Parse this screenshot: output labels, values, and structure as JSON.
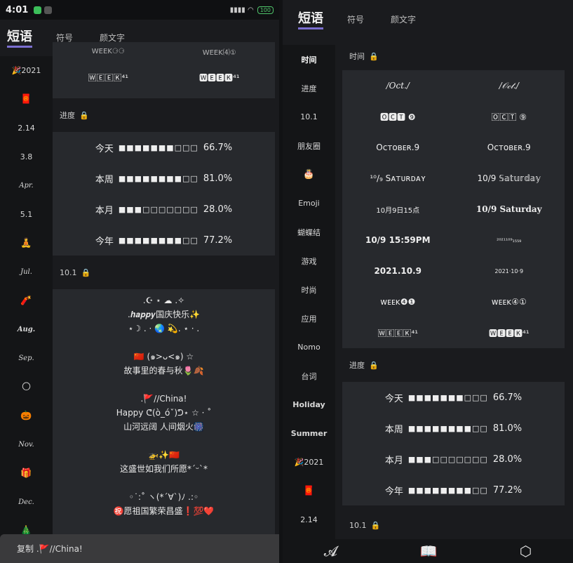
{
  "status_bar": {
    "time": "4:01",
    "battery": "100",
    "right_icons": "▮▮▮▮  ◠"
  },
  "tabs": {
    "active": "短语",
    "symbol": "符号",
    "kaomoji": "颜文字"
  },
  "left": {
    "sidebar": [
      "🎉2021",
      "🧧",
      "2.14",
      "3.8",
      "Apr.",
      "5.1",
      "🧘",
      "Jul.",
      "🧨",
      "Aug.",
      "Sep.",
      "🌕",
      "🎃",
      "Nov.",
      "🎁",
      "Dec.",
      "🎄"
    ],
    "cutoff_row": [
      "WEEK⚆⚆",
      "WEEK⑷①"
    ],
    "week_row": [
      "🅆🄴🄴🄺⁴¹",
      "🆆🅴🅴🅺⁴¹"
    ],
    "progress_header": "进度",
    "progress": [
      {
        "label": "今天",
        "bar": "■■■■■■■□□□",
        "pct": "66.7%"
      },
      {
        "label": "本周",
        "bar": "■■■■■■■■□□",
        "pct": "81.0%"
      },
      {
        "label": "本月",
        "bar": "■■■□□□□□□□",
        "pct": "28.0%"
      },
      {
        "label": "今年",
        "bar": "■■■■■■■■□□",
        "pct": "77.2%"
      }
    ],
    "s101_header": "10.1",
    "s101_blocks": [
      [
        ".☪︎ ⋆ ☁︎ .✧",
        ".𝒉𝒂𝒑𝒑𝒚国庆快乐✨",
        "⋆☽ . · 🌏 💫. ⋆ · ."
      ],
      [
        "🇨🇳 (๑>ᴗ<๑) ☆",
        "故事里的春与秋🌷🍂"
      ],
      [
        ".🚩//China!",
        "Happy ᕦ(ò_óˇ)ᕤ⋆ ☆ · ˚",
        "山河远阔 人间烟火🎆"
      ],
      [
        "🚁✨🇨🇳",
        "这盛世如我们所愿*ˊᵕˋ*"
      ],
      [
        "◦˙:˚ ヽ(*´∀`)ﾉ .:◦",
        "㊗️愿祖国繁荣昌盛❗💯❤️"
      ]
    ],
    "toast": "复制 .🚩//China!"
  },
  "right": {
    "sidebar": [
      "时间",
      "进度",
      "10.1",
      "朋友圈",
      "🎂",
      "Emoji",
      "蝴蝶结",
      "游戏",
      "时尚",
      "应用",
      "Nomo",
      "台词",
      "Holiday",
      "Summer",
      "🎉2021",
      "🧧",
      "2.14"
    ],
    "time_header": "时间",
    "time_rows": [
      [
        "/Oct./",
        "/𝒪𝒸𝓉./"
      ],
      [
        "🅾🅲🆃 ❾",
        "🄾🄲🅃 ⑨"
      ],
      [
        "Oᴄᴛᴏʙᴇʀ.9",
        "Oᴄᴛᴏʙᴇʀ.9"
      ],
      [
        "¹⁰/₉ Sᴀᴛᴜʀᴅᴀʏ",
        "10/9 𝕊𝕒𝕥𝕦𝕣𝕕𝕒𝕪"
      ],
      [
        "10月9日15点",
        "10/9 Saturday"
      ],
      [
        "10/9 15:59PM",
        "²⁰²¹¹⁰⁹₁₅₅₉"
      ],
      [
        "2021.10.9",
        "2021·10·9"
      ],
      [
        "ᴡᴇᴇᴋ❹❶",
        "ᴡᴇᴇᴋ④①"
      ],
      [
        "🅆🄴🄴🄺⁴¹",
        "🆆🅴🅴🅺⁴¹"
      ]
    ],
    "progress_header": "进度",
    "progress": [
      {
        "label": "今天",
        "bar": "■■■■■■■□□□",
        "pct": "66.7%"
      },
      {
        "label": "本周",
        "bar": "■■■■■■■■□□",
        "pct": "81.0%"
      },
      {
        "label": "本月",
        "bar": "■■■□□□□□□□",
        "pct": "28.0%"
      },
      {
        "label": "今年",
        "bar": "■■■■■■■■□□",
        "pct": "77.2%"
      }
    ],
    "s101_header": "10.1",
    "bottom_nav": [
      "𝓐",
      "📖",
      "⬡"
    ]
  }
}
